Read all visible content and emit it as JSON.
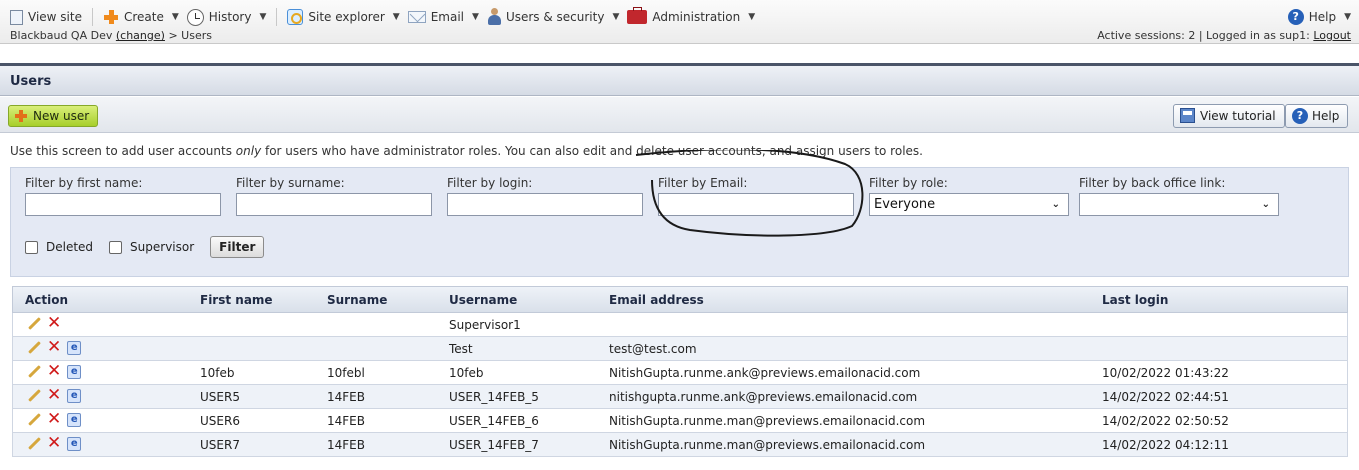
{
  "toolbar": {
    "view_site": "View site",
    "create": "Create",
    "history": "History",
    "site_explorer": "Site explorer",
    "email": "Email",
    "users_security": "Users & security",
    "administration": "Administration",
    "help": "Help"
  },
  "breadcrumb": {
    "site": "Blackbaud QA Dev",
    "change": "(change)",
    "sep": " > ",
    "page": "Users"
  },
  "session": {
    "text": "Active sessions: 2 | Logged in as sup1:",
    "logout": "Logout"
  },
  "page_title": "Users",
  "actions": {
    "new_user": "New user",
    "view_tutorial": "View tutorial",
    "help": "Help"
  },
  "intro": {
    "before": "Use this screen to add user accounts ",
    "em": "only",
    "after": " for users who have administrator roles. You can also edit and delete user accounts, and assign users to roles."
  },
  "filters": {
    "first_name_label": "Filter by first name:",
    "first_name_value": "",
    "surname_label": "Filter by surname:",
    "surname_value": "",
    "login_label": "Filter by login:",
    "login_value": "",
    "email_label": "Filter by Email:",
    "email_value": "",
    "role_label": "Filter by role:",
    "role_value": "Everyone",
    "backoffice_label": "Filter by back office link:",
    "backoffice_value": "",
    "deleted_label": "Deleted",
    "supervisor_label": "Supervisor",
    "filter_button": "Filter"
  },
  "table": {
    "headers": [
      "Action",
      "First name",
      "Surname",
      "Username",
      "Email address",
      "Last login"
    ],
    "rows": [
      {
        "first": "",
        "surname": "",
        "username": "Supervisor1",
        "email": "",
        "last_login": "",
        "has_mail": false
      },
      {
        "first": "",
        "surname": "",
        "username": "Test",
        "email": "test@test.com",
        "last_login": "",
        "has_mail": true
      },
      {
        "first": "10feb",
        "surname": "10febl",
        "username": "10feb",
        "email": "NitishGupta.runme.ank@previews.emailonacid.com",
        "last_login": "10/02/2022 01:43:22",
        "has_mail": true
      },
      {
        "first": "USER5",
        "surname": "14FEB",
        "username": "USER_14FEB_5",
        "email": "nitishgupta.runme.ank@previews.emailonacid.com",
        "last_login": "14/02/2022 02:44:51",
        "has_mail": true
      },
      {
        "first": "USER6",
        "surname": "14FEB",
        "username": "USER_14FEB_6",
        "email": "NitishGupta.runme.man@previews.emailonacid.com",
        "last_login": "14/02/2022 02:50:52",
        "has_mail": true
      },
      {
        "first": "USER7",
        "surname": "14FEB",
        "username": "USER_14FEB_7",
        "email": "NitishGupta.runme.man@previews.emailonacid.com",
        "last_login": "14/02/2022 04:12:11",
        "has_mail": true
      }
    ]
  },
  "icons": {
    "edit": "pencil-icon",
    "delete": "red-x-icon",
    "mail": "email-icon",
    "help": "question-icon"
  },
  "colors": {
    "accent_green": "#a7cf2b",
    "delete_red": "#d01a1a",
    "title_navy": "#1f2a44",
    "filter_bg": "#e4e9f4"
  }
}
